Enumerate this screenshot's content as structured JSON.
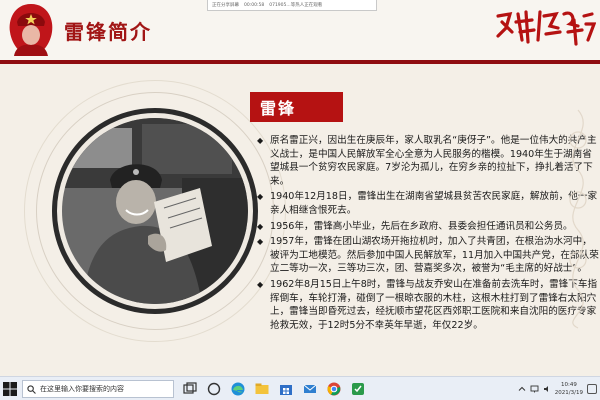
{
  "share_bar": {
    "items": [
      "正在分享屏幕",
      "00:00:58",
      "071905...等热人正在观看"
    ]
  },
  "slide": {
    "title": "雷锋简介",
    "calligraphy_alt": "向雷锋学习",
    "name_tag": "雷锋",
    "bullet_symbol": "◆",
    "bio": [
      "原名雷正兴，因出生在庚辰年，家人取乳名“庚伢子”。他是一位伟大的共产主义战士，是中国人民解放军全心全意为人民服务的楷模。1940年生于湖南省望城县一个贫穷农民家庭。7岁沦为孤儿，在穷乡亲的拉扯下，挣扎着活了下来。",
      "1940年12月18日，雷锋出生在湖南省望城县贫苦农民家庭，解放前，他一家亲人相继含恨死去。",
      "1956年，雷锋高小毕业，先后在乡政府、县委会担任通讯员和公务员。",
      "1957年，雷锋在团山湖农场开拖拉机时，加入了共青团，在根治沩水河中，被评为工地模范。然后参加中国人民解放军，11月加入中国共产党，在部队荣立二等功一次，三等功三次，团、营嘉奖多次，被誉为“毛主席的好战士”。",
      "1962年8月15日上午8时，雷锋与战友乔安山在准备前去洗车时，雷锋下车指挥倒车，车轮打滑，碰倒了一根晾衣服的木柱，这根木柱打到了雷锋右太阳穴上，雷锋当即昏死过去，经抚顺市望花区西郊职工医院和来自沈阳的医疗专家抢救无效，于12时5分不幸英年早逝，年仅22岁。"
    ]
  },
  "taskbar": {
    "search_placeholder": "在这里输入你要搜索的内容",
    "icons": [
      "windows-start-icon",
      "search-icon",
      "task-view-icon",
      "edge-icon",
      "file-explorer-icon",
      "store-icon",
      "mail-icon",
      "chrome-icon",
      "app-icon"
    ],
    "time": "10:49",
    "date": "2021/3/19"
  },
  "colors": {
    "accent_red": "#b51212",
    "title_red": "#a11515",
    "header_line": "#8f0d10",
    "background": "#f4efe7"
  }
}
